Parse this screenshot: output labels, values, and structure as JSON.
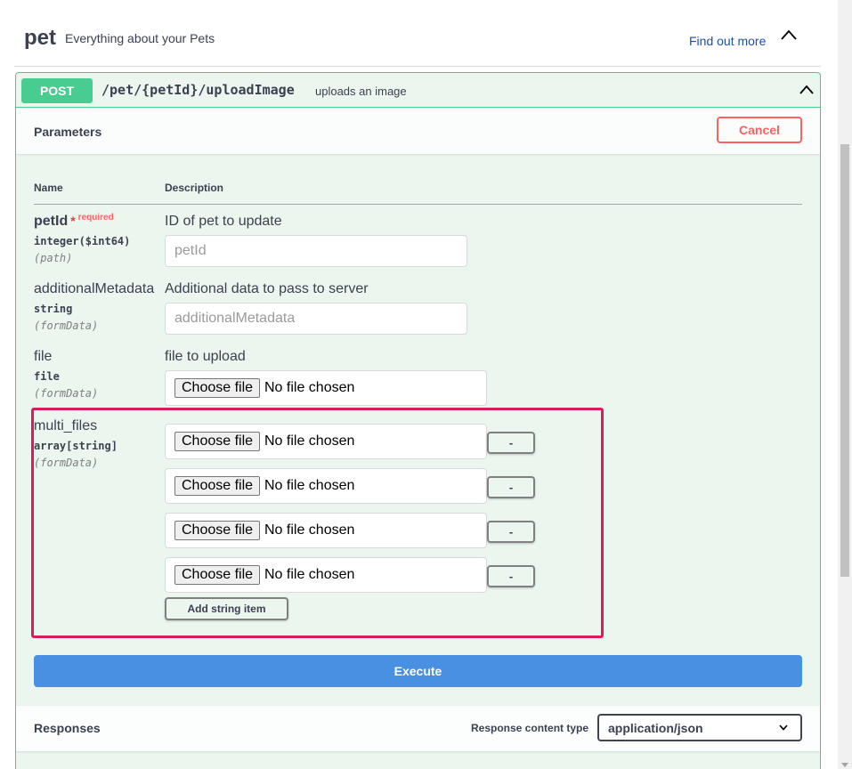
{
  "tag": {
    "name": "pet",
    "description": "Everything about your Pets",
    "find_more": "Find out more"
  },
  "operation": {
    "method": "POST",
    "path": "/pet/{petId}/uploadImage",
    "summary": "uploads an image"
  },
  "parameters_section": {
    "title": "Parameters",
    "cancel_label": "Cancel",
    "col_name": "Name",
    "col_description": "Description"
  },
  "params": [
    {
      "name": "petId",
      "required_star": "*",
      "required_text": "required",
      "type": "integer($int64)",
      "in": "(path)",
      "description": "ID of pet to update",
      "placeholder": "petId"
    },
    {
      "name": "additionalMetadata",
      "type": "string",
      "in": "(formData)",
      "description": "Additional data to pass to server",
      "placeholder": "additionalMetadata"
    },
    {
      "name": "file",
      "type": "file",
      "in": "(formData)",
      "description": "file to upload",
      "file_button": "Choose file",
      "file_status": "No file chosen"
    },
    {
      "name": "multi_files",
      "type": "array[string]",
      "in": "(formData)",
      "items": [
        {
          "file_button": "Choose file",
          "file_status": "No file chosen",
          "remove_label": "-"
        },
        {
          "file_button": "Choose file",
          "file_status": "No file chosen",
          "remove_label": "-"
        },
        {
          "file_button": "Choose file",
          "file_status": "No file chosen",
          "remove_label": "-"
        },
        {
          "file_button": "Choose file",
          "file_status": "No file chosen",
          "remove_label": "-"
        }
      ],
      "add_label": "Add string item"
    }
  ],
  "execute_label": "Execute",
  "responses": {
    "title": "Responses",
    "content_type_label": "Response content type",
    "content_type_value": "application/json"
  },
  "colors": {
    "post": "#49cc90",
    "execute": "#4990e2",
    "cancel": "#ff6060",
    "highlight": "#e0185e"
  }
}
